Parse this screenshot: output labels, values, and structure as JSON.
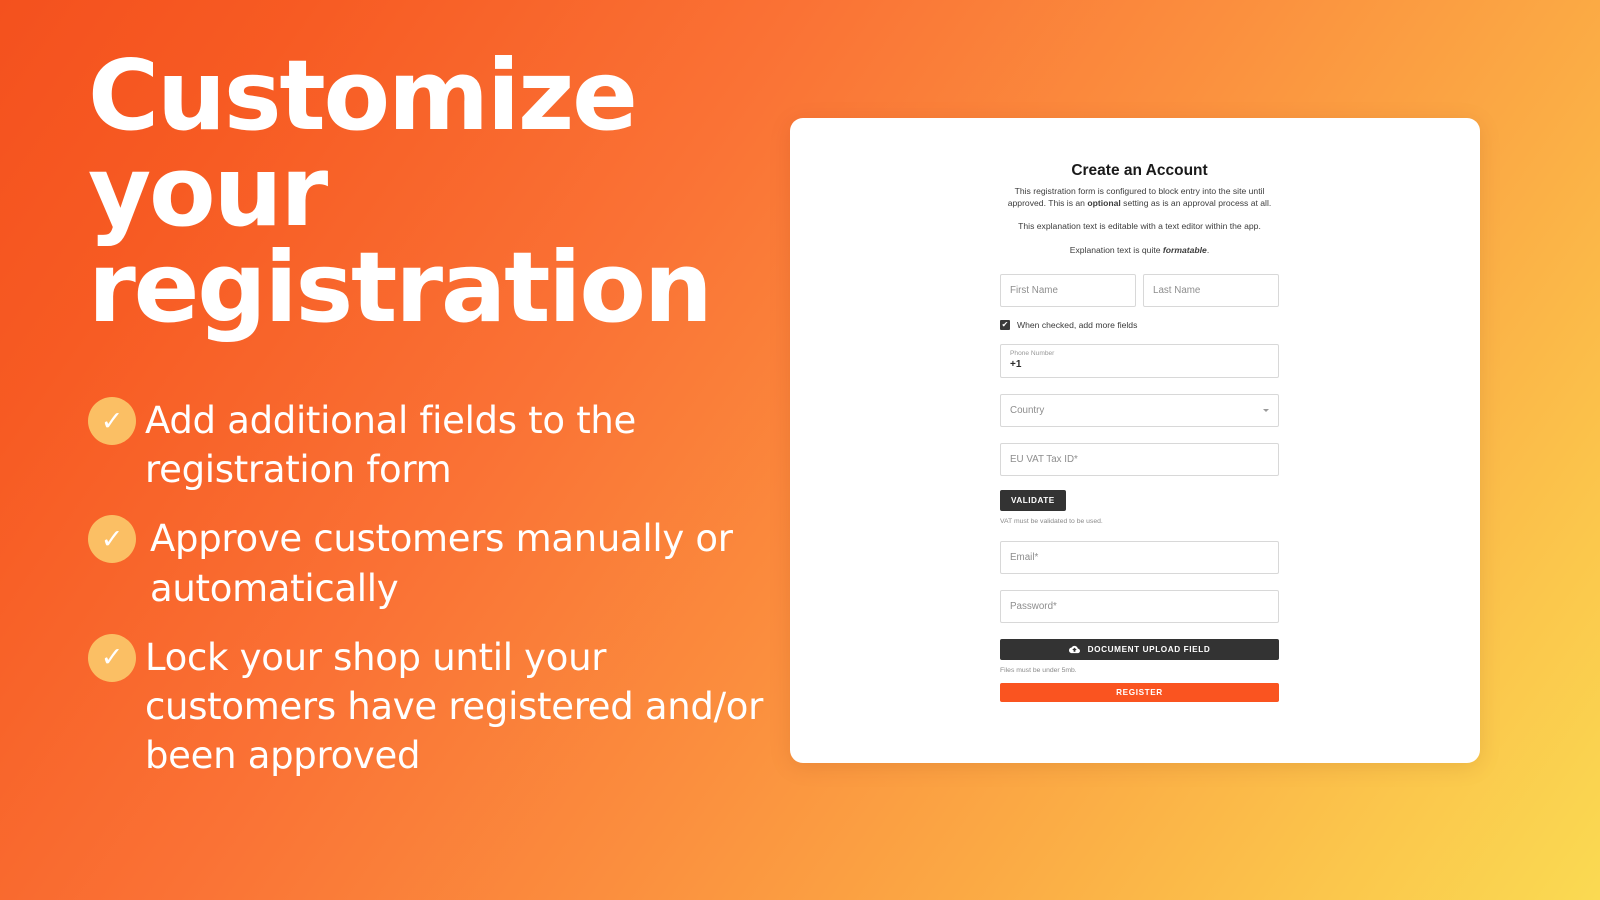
{
  "promo": {
    "headline": "Customize your registration",
    "bullets": [
      "Add additional fields to the registration form",
      "Approve customers manually or automatically",
      "Lock your shop until your customers have registered and/or been approved"
    ],
    "check_icon": "✓",
    "accent_orange": "#F4511E",
    "accent_yellow": "#FADA52",
    "check_circle_color": "#FBBF64"
  },
  "form": {
    "title": "Create an Account",
    "intro_line1": "This registration form is configured to block entry into the site until",
    "intro_line2_pre": "approved. This is an ",
    "intro_line2_bold": "optional",
    "intro_line2_post": " setting as is an approval process at all.",
    "intro_line3": "This explanation text is editable with a text editor within the app.",
    "intro_line4_pre": "Explanation text is quite ",
    "intro_line4_em": "formatable",
    "intro_line4_post": ".",
    "first_name_placeholder": "First Name",
    "last_name_placeholder": "Last Name",
    "checkbox_label": "When checked, add more fields",
    "checkbox_checked": true,
    "checkbox_glyph": "✔",
    "phone_label": "Phone Number",
    "phone_value": "+1",
    "country_placeholder": "Country",
    "vat_placeholder": "EU VAT Tax ID*",
    "validate_label": "VALIDATE",
    "vat_helper": "VAT must be validated to be used.",
    "email_placeholder": "Email*",
    "password_placeholder": "Password*",
    "upload_label": "DOCUMENT UPLOAD FIELD",
    "upload_icon": "cloud-upload-icon",
    "upload_helper": "Files must be under 5mb.",
    "register_label": "REGISTER",
    "register_color": "#FA5420",
    "button_dark_color": "#333333"
  }
}
